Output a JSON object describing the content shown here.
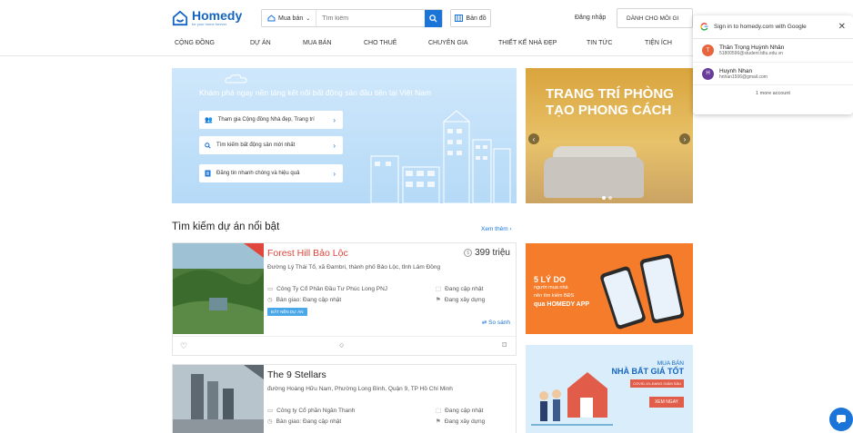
{
  "header": {
    "logo_text": "Homedy",
    "logo_tagline": "for your home forever",
    "search_type": "Mua bán",
    "search_placeholder": "Tìm kiếm",
    "map_label": "Bản đồ",
    "login_label": "Đăng nhập",
    "partner_label": "DÀNH CHO MÔI GI"
  },
  "nav": {
    "items": [
      {
        "label": "CỘNG ĐỒNG"
      },
      {
        "label": "DỰ ÁN"
      },
      {
        "label": "MUA BÁN"
      },
      {
        "label": "CHO THUÊ"
      },
      {
        "label": "CHUYÊN GIA"
      },
      {
        "label": "THIẾT KẾ NHÀ ĐẸP"
      },
      {
        "label": "TIN TỨC"
      },
      {
        "label": "TIỆN ÍCH"
      }
    ]
  },
  "hero": {
    "title": "Khám phá ngay nền tảng kết nối bất động sản đầu tiên tại Việt Nam",
    "cards": [
      {
        "label": "Tham gia Cộng đồng Nhà đẹp, Trang trí",
        "icon": "people-icon"
      },
      {
        "label": "Tìm kiếm bất động sản mới nhất",
        "icon": "search-icon"
      },
      {
        "label": "Đăng tin nhanh chóng và hiệu quả",
        "icon": "document-icon"
      }
    ]
  },
  "banner": {
    "line1": "TRANG TRÍ PHÒNG",
    "line2": "TẠO PHONG CÁCH"
  },
  "projects": {
    "section_title": "Tìm kiếm dự án nổi bật",
    "see_more": "Xem thêm ›",
    "compare_label": "So sánh",
    "items": [
      {
        "title": "Forest Hill Bảo Lộc",
        "price": "399 triệu",
        "address": "Đường Lý Thái Tổ, xã Đambri, thành phố Bảo Lộc, tỉnh Lâm Đồng",
        "developer": "Công Ty Cổ Phần Đầu Tư Phúc Long PNJ",
        "area": "Đang cập nhật",
        "handover": "Bàn giao: Đang cập nhật",
        "status": "Đang xây dựng",
        "tag": "ĐẤT NỀN DỰ ÁN"
      },
      {
        "title": "The 9 Stellars",
        "address": "đường Hoàng Hữu Nam, Phường Long Bình, Quận 9, TP Hồ Chí Minh",
        "developer": "Công ty Cổ phần Ngân Thanh",
        "area": "Đang cập nhật",
        "handover": "Bàn giao: Đang cập nhật",
        "status": "Đang xây dựng"
      }
    ]
  },
  "ads": {
    "ad1_line1": "5 LÝ DO",
    "ad1_line2": "người mua nhà",
    "ad1_line3": "nên tìm kiếm BĐS",
    "ad1_line4": "qua HOMEDY APP",
    "ad2_line1": "MUA BÁN",
    "ad2_line2": "NHÀ BẤT GIÁ TỐT",
    "ad2_line3": "COVID-19–ĐANG GIẢM SÂU",
    "ad2_button": "XEM NGAY"
  },
  "google_popup": {
    "title": "Sign in to homedy.com with Google",
    "accounts": [
      {
        "initial": "T",
        "name": "Thân Trọng Huỳnh Nhân",
        "email": "51800596@student.tdtu.edu.vn",
        "color": "#e8663d"
      },
      {
        "initial": "H",
        "name": "Huynh Nhan",
        "email": "hnhan1506@gmail.com",
        "color": "#6a3d9a"
      }
    ],
    "more_label": "1 more account"
  }
}
